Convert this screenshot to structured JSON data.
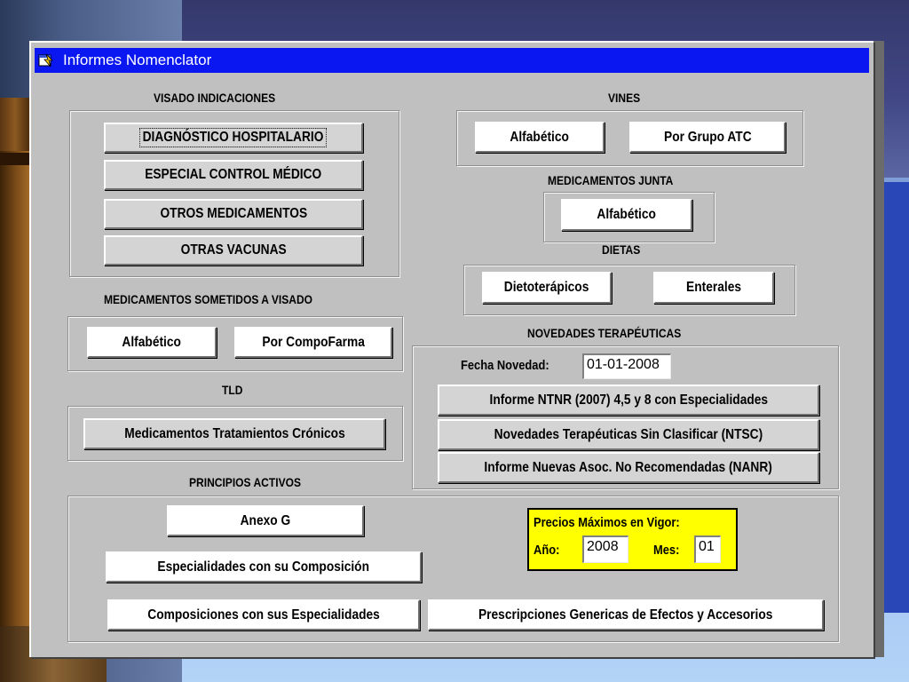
{
  "window": {
    "title": "Informes Nomenclator"
  },
  "visado_indicaciones": {
    "heading": "VISADO INDICACIONES",
    "buttons": [
      "DIAGNÓSTICO HOSPITALARIO",
      "ESPECIAL CONTROL MÉDICO",
      "OTROS MEDICAMENTOS",
      "OTRAS VACUNAS"
    ]
  },
  "vines": {
    "heading": "VINES",
    "alfabetico": "Alfabético",
    "grupo_atc": "Por Grupo ATC"
  },
  "medicamentos_junta": {
    "heading": "MEDICAMENTOS JUNTA",
    "alfabetico": "Alfabético"
  },
  "dietas": {
    "heading": "DIETAS",
    "dietoterapicos": "Dietoterápicos",
    "enterales": "Enterales"
  },
  "medicamentos_visado": {
    "heading": "MEDICAMENTOS SOMETIDOS A VISADO",
    "alfabetico": "Alfabético",
    "compofarma": "Por CompoFarma"
  },
  "tld": {
    "heading": "TLD",
    "cronicos": "Medicamentos Tratamientos Crónicos"
  },
  "novedades": {
    "heading": "NOVEDADES TERAPÉUTICAS",
    "fecha_label": "Fecha Novedad:",
    "fecha_value": "01-01-2008",
    "ntnr": "Informe NTNR (2007) 4,5 y 8 con Especialidades",
    "ntsc": "Novedades Terapéuticas Sin Clasificar (NTSC)",
    "nanr": "Informe Nuevas Asoc. No Recomendadas (NANR)"
  },
  "principios_activos": {
    "heading": "PRINCIPIOS ACTIVOS",
    "anexo_g": "Anexo G",
    "especialidades_composicion": "Especialidades con su Composición",
    "composiciones_especialidades": "Composiciones con sus Especialidades",
    "prescripciones": "Prescripciones Genericas de Efectos y Accesorios"
  },
  "precios": {
    "heading": "Precios Máximos en Vigor:",
    "anio_label": "Año:",
    "anio_value": "2008",
    "mes_label": "Mes:",
    "mes_value": "01"
  },
  "icons": {
    "app": "app-window-icon"
  },
  "colors": {
    "titlebar": "#0a17f0",
    "window_bg": "#c0c0c0",
    "highlight": "#ffff00"
  }
}
